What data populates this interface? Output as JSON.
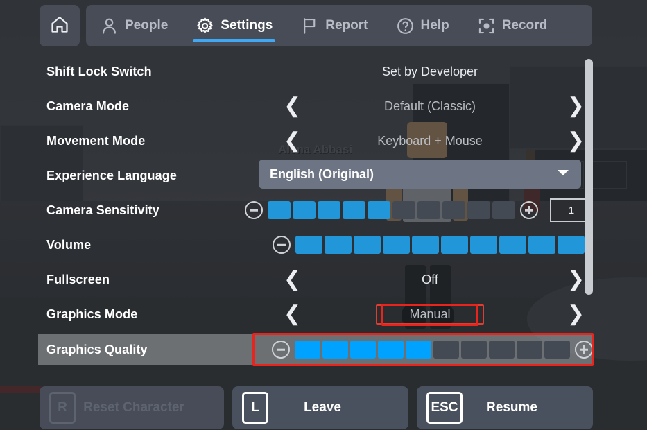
{
  "topbar": {
    "home_icon": "home-icon",
    "tabs": [
      {
        "label": "People",
        "icon": "people-icon",
        "active": false
      },
      {
        "label": "Settings",
        "icon": "gear-icon",
        "active": true
      },
      {
        "label": "Report",
        "icon": "flag-icon",
        "active": false
      },
      {
        "label": "Help",
        "icon": "question-icon",
        "active": false
      },
      {
        "label": "Record",
        "icon": "record-icon",
        "active": false
      }
    ]
  },
  "settings": {
    "rows": [
      {
        "label": "Shift Lock Switch",
        "type": "text",
        "value": "Set by Developer"
      },
      {
        "label": "Camera Mode",
        "type": "stepper",
        "value": "Default (Classic)"
      },
      {
        "label": "Movement Mode",
        "type": "stepper",
        "value": "Keyboard + Mouse"
      },
      {
        "label": "Experience Language",
        "type": "dropdown",
        "value": "English (Original)"
      },
      {
        "label": "Camera Sensitivity",
        "type": "slider",
        "filled": 5,
        "total": 10,
        "textbox": "1"
      },
      {
        "label": "Volume",
        "type": "slider",
        "filled": 10,
        "total": 10
      },
      {
        "label": "Fullscreen",
        "type": "stepper",
        "value": "Off"
      },
      {
        "label": "Graphics Mode",
        "type": "stepper",
        "value": "Manual",
        "annotated": true
      },
      {
        "label": "Graphics Quality",
        "type": "slider",
        "filled": 5,
        "total": 10,
        "annotated": true,
        "highlighted": true
      }
    ]
  },
  "bottom": {
    "buttons": [
      {
        "key": "R",
        "label": "Reset Character",
        "disabled": true
      },
      {
        "key": "L",
        "label": "Leave",
        "disabled": false
      },
      {
        "key": "ESC",
        "label": "Resume",
        "disabled": false
      }
    ]
  },
  "scene": {
    "player_name": "Alena Abbasi"
  },
  "colors": {
    "accent_blue": "#3fa9f5",
    "slider_blue": "#2196d9",
    "slider_blue_bright": "#00a2ff",
    "slider_empty": "#434a54",
    "annotation_red": "#e8241c",
    "panel_bar": "#474c57",
    "button_bg": "#49505e"
  }
}
